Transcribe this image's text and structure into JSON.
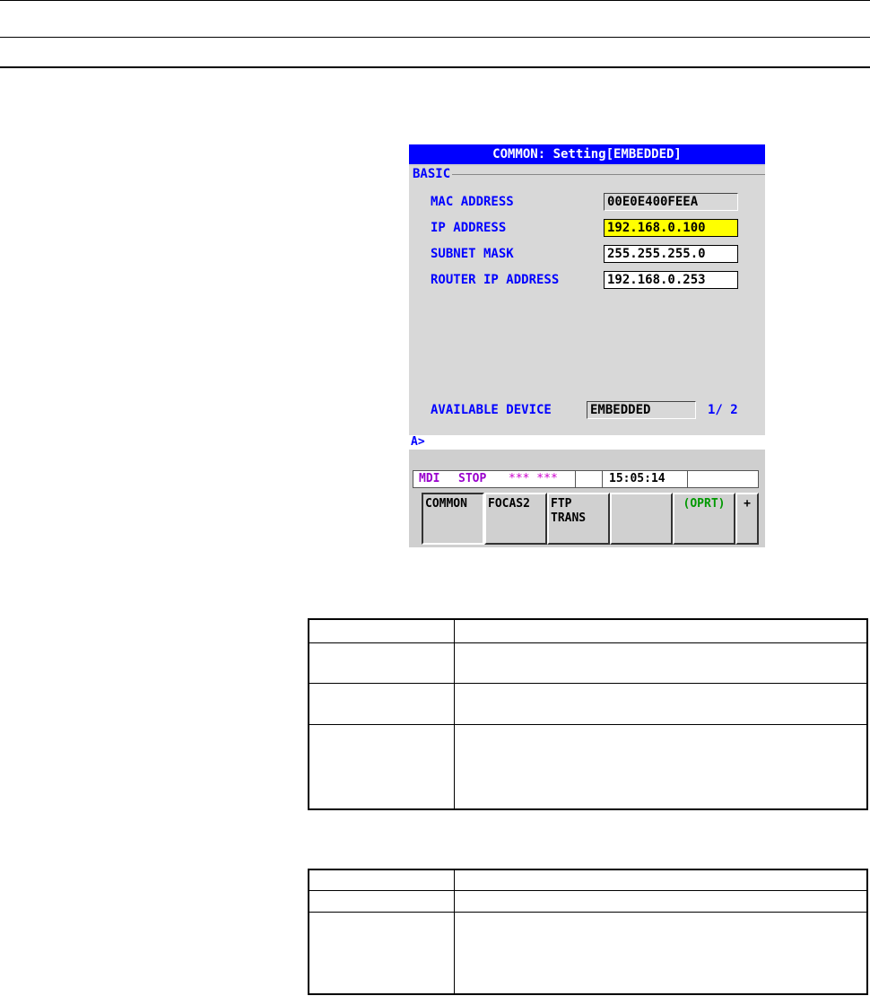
{
  "screen": {
    "title": "COMMON: Setting[EMBEDDED]",
    "group_label": "BASIC",
    "fields": [
      {
        "label": "MAC ADDRESS",
        "value": "00E0E400FEEA"
      },
      {
        "label": "IP ADDRESS",
        "value": "192.168.0.100"
      },
      {
        "label": "SUBNET MASK",
        "value": "255.255.255.0"
      },
      {
        "label": "ROUTER IP ADDRESS",
        "value": "192.168.0.253"
      }
    ],
    "available_device_label": "AVAILABLE DEVICE",
    "available_device_value": "EMBEDDED",
    "page_indicator": "1/ 2",
    "prompt": "A>",
    "status": {
      "mode": "MDI",
      "run_state": "STOP",
      "alarm": "*** ***",
      "time": "15:05:14"
    },
    "softkeys": [
      "COMMON",
      "FOCAS2",
      "FTP\nTRANS",
      "",
      "(OPRT)",
      "+"
    ]
  },
  "colors": {
    "title_bg": "#0000ff",
    "label_text": "#0000ff",
    "selected_field": "#ffff00",
    "oprt_text": "#009900",
    "status_text": "#9900cc"
  }
}
